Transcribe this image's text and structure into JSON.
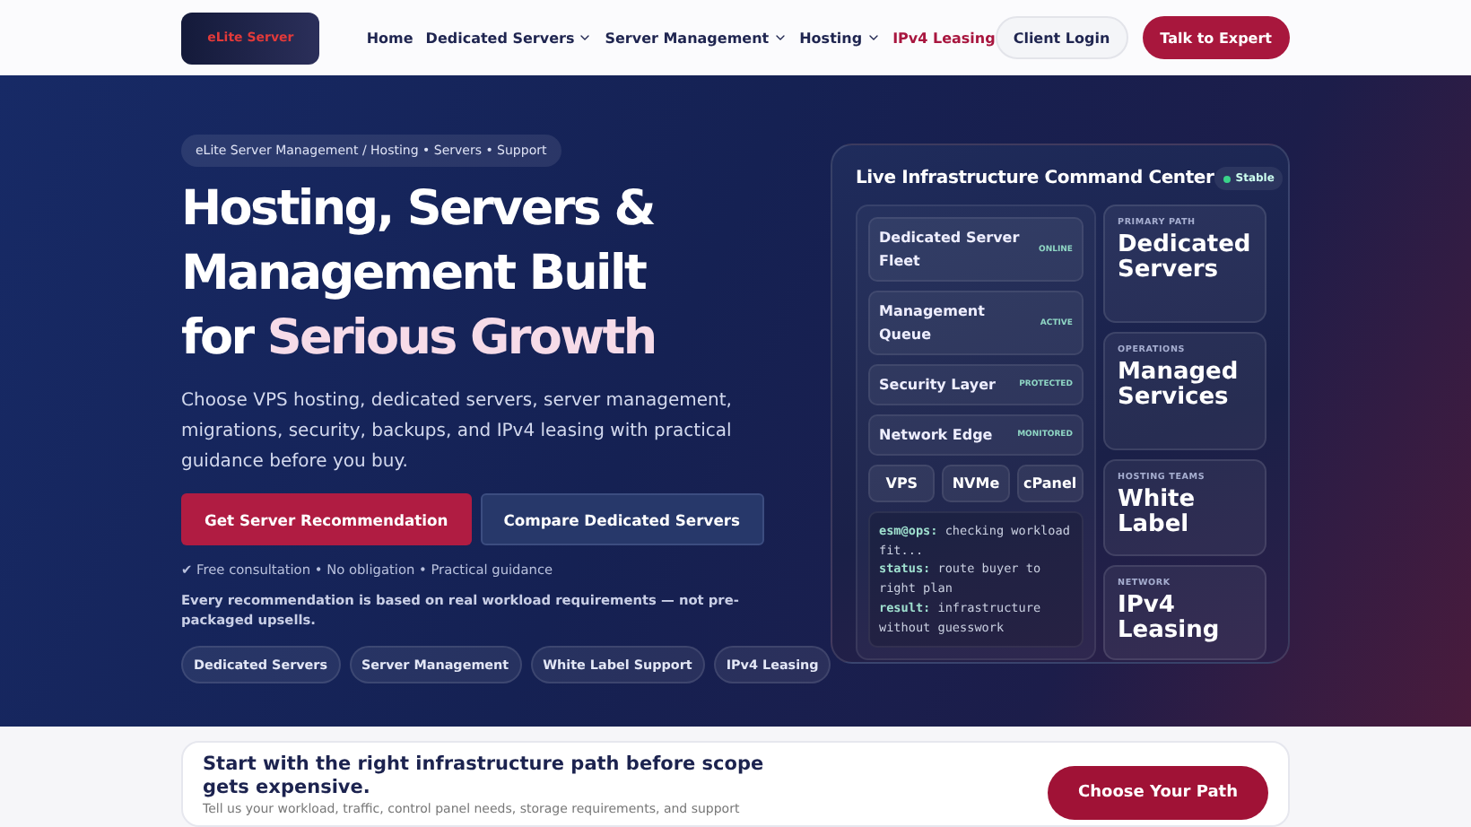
{
  "nav": {
    "logo_text": "eLite Server",
    "links": [
      {
        "label": "Home",
        "dropdown": false,
        "highlighted": false
      },
      {
        "label": "Dedicated Servers",
        "dropdown": true,
        "highlighted": false
      },
      {
        "label": "Server Management",
        "dropdown": true,
        "highlighted": false
      },
      {
        "label": "Hosting",
        "dropdown": true,
        "highlighted": false
      },
      {
        "label": "IPv4 Leasing",
        "dropdown": false,
        "highlighted": true
      }
    ],
    "login": "Client Login",
    "cta": "Talk to Expert"
  },
  "hero": {
    "breadcrumb": "eLite Server Management / Hosting • Servers • Support",
    "title_lines": [
      "Hosting, Servers &",
      "Management Built"
    ],
    "title_plain": "for ",
    "title_accent": "Serious Growth",
    "description": "Choose VPS hosting, dedicated servers, server management, migrations, security, backups, and IPv4 leasing with practical guidance before you buy.",
    "primary_button": "Get Server Recommendation",
    "secondary_button": "Compare Dedicated Servers",
    "checkline": "✔ Free consultation • No obligation • Practical guidance",
    "note": "Every recommendation is based on real workload requirements — not pre-packaged upsells.",
    "tags": [
      "Dedicated Servers",
      "Server Management",
      "White Label Support",
      "IPv4 Leasing"
    ]
  },
  "panel": {
    "title": "Live Infrastructure Command Center",
    "status": "Stable",
    "services": [
      {
        "name": "Dedicated Server Fleet",
        "state": "ONLINE"
      },
      {
        "name": "Management Queue",
        "state": "ACTIVE"
      },
      {
        "name": "Security Layer",
        "state": "PROTECTED"
      },
      {
        "name": "Network Edge",
        "state": "MONITORED"
      }
    ],
    "chips": [
      "VPS",
      "NVMe",
      "cPanel"
    ],
    "terminal": [
      {
        "key": "esm@ops:",
        "text": " checking workload fit..."
      },
      {
        "key": "status:",
        "text": " route buyer to right plan"
      },
      {
        "key": "result:",
        "text": " infrastructure without guesswork"
      }
    ],
    "tiles": [
      {
        "label": "PRIMARY PATH",
        "value": "Dedicated Servers"
      },
      {
        "label": "OPERATIONS",
        "value": "Managed Services"
      },
      {
        "label": "HOSTING TEAMS",
        "value": "White Label"
      },
      {
        "label": "NETWORK",
        "value": "IPv4 Leasing"
      }
    ]
  },
  "path_card": {
    "heading": "Start with the right infrastructure path before scope gets expensive.",
    "text": "Tell us your workload, traffic, control panel needs, storage requirements, and support",
    "button": "Choose Your Path"
  }
}
